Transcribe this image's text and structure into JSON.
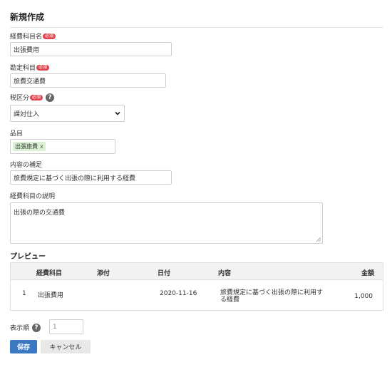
{
  "page": {
    "title": "新規作成"
  },
  "fields": {
    "expense_item_name": {
      "label": "経費科目名",
      "required": "必須",
      "value": "出張費用"
    },
    "account": {
      "label": "勘定科目",
      "required": "必須",
      "value": "旅費交通費"
    },
    "tax_category": {
      "label": "税区分",
      "required": "必須",
      "help": "?",
      "value": "課対仕入"
    },
    "item": {
      "label": "品目",
      "tag": "出張旅費",
      "tag_remove": "x"
    },
    "supplement": {
      "label": "内容の補足",
      "value": "旅費規定に基づく出張の際に利用する経費"
    },
    "description": {
      "label": "経費科目の説明",
      "value": "出張の際の交通費"
    }
  },
  "preview": {
    "label": "プレビュー",
    "columns": [
      "経費科目",
      "添付",
      "日付",
      "内容",
      "金額"
    ],
    "rows": [
      {
        "no": "1",
        "expense_item": "出張費用",
        "attachment": "",
        "date": "2020-11-16",
        "content": "旅費規定に基づく出張の際に利用する経費",
        "amount": "1,000"
      }
    ]
  },
  "display_order": {
    "label": "表示順",
    "help": "?",
    "value": "1"
  },
  "buttons": {
    "save": "保存",
    "cancel": "キャンセル"
  },
  "colors": {
    "primary": "#3a78c2",
    "required_badge": "#e0454f",
    "tag_bg": "#d9f0d3"
  }
}
